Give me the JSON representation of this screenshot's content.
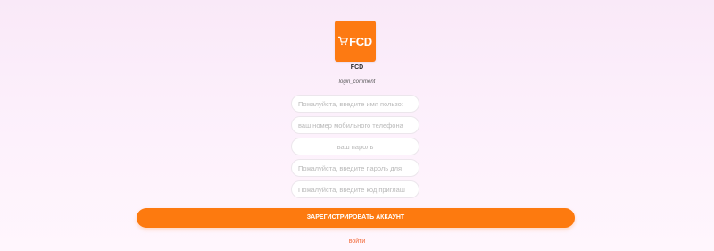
{
  "app": {
    "logo_text": "FCD",
    "logo_icon": "cart-icon",
    "name": "FCD",
    "comment": "login_comment",
    "brand_color": "#fd7a12"
  },
  "form": {
    "username_placeholder": "Пожалуйста, введите имя пользо:",
    "phone_placeholder": "ваш номер мобильного телефона",
    "password_placeholder": "ваш пароль",
    "confirm_password_placeholder": "Пожалуйста, введите пароль для",
    "invite_code_placeholder": "Пожалуйста, введите код приглаш"
  },
  "actions": {
    "register_label": "ЗАРЕГИСТРИРОВАТЬ АККАУНТ",
    "login_label": "войти",
    "link_color": "#f26a3a"
  }
}
